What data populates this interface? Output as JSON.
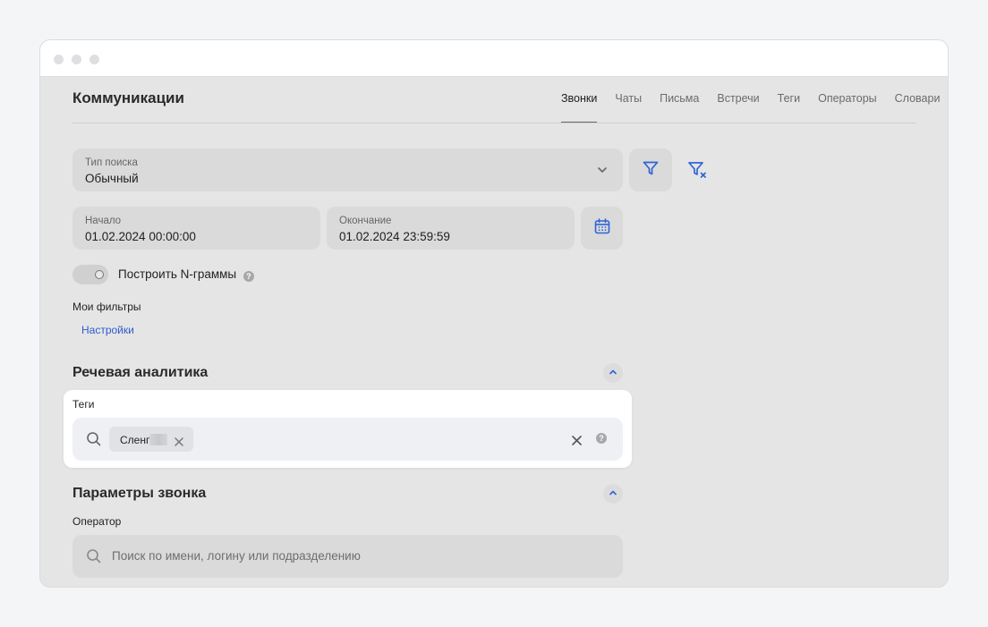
{
  "header": {
    "title": "Коммуникации",
    "tabs": [
      {
        "label": "Звонки",
        "active": true
      },
      {
        "label": "Чаты",
        "active": false
      },
      {
        "label": "Письма",
        "active": false
      },
      {
        "label": "Встречи",
        "active": false
      },
      {
        "label": "Теги",
        "active": false
      },
      {
        "label": "Операторы",
        "active": false
      },
      {
        "label": "Словари",
        "active": false
      }
    ]
  },
  "search_type": {
    "label": "Тип поиска",
    "value": "Обычный",
    "icon": "chevron-down-icon"
  },
  "filter_buttons": {
    "filter_icon": "filter-icon",
    "clear_icon": "filter-clear-icon",
    "accent": "#2f63d8"
  },
  "period": {
    "start": {
      "label": "Начало",
      "value": "01.02.2024 00:00:00"
    },
    "end": {
      "label": "Окончание",
      "value": "01.02.2024 23:59:59"
    },
    "calendar_icon": "calendar-icon"
  },
  "ngrams": {
    "label": "Построить N-граммы",
    "enabled": false,
    "help": "?"
  },
  "my_filters": {
    "title": "Мои фильтры",
    "settings_link": "Настройки"
  },
  "speech_analytics": {
    "title": "Речевая аналитика",
    "tags": {
      "label": "Теги",
      "chips": [
        {
          "label": "Сленг"
        }
      ],
      "help": "?"
    }
  },
  "call_params": {
    "title": "Параметры звонка",
    "operator": {
      "label": "Оператор",
      "placeholder": "Поиск по имени, логину или подразделению"
    }
  }
}
